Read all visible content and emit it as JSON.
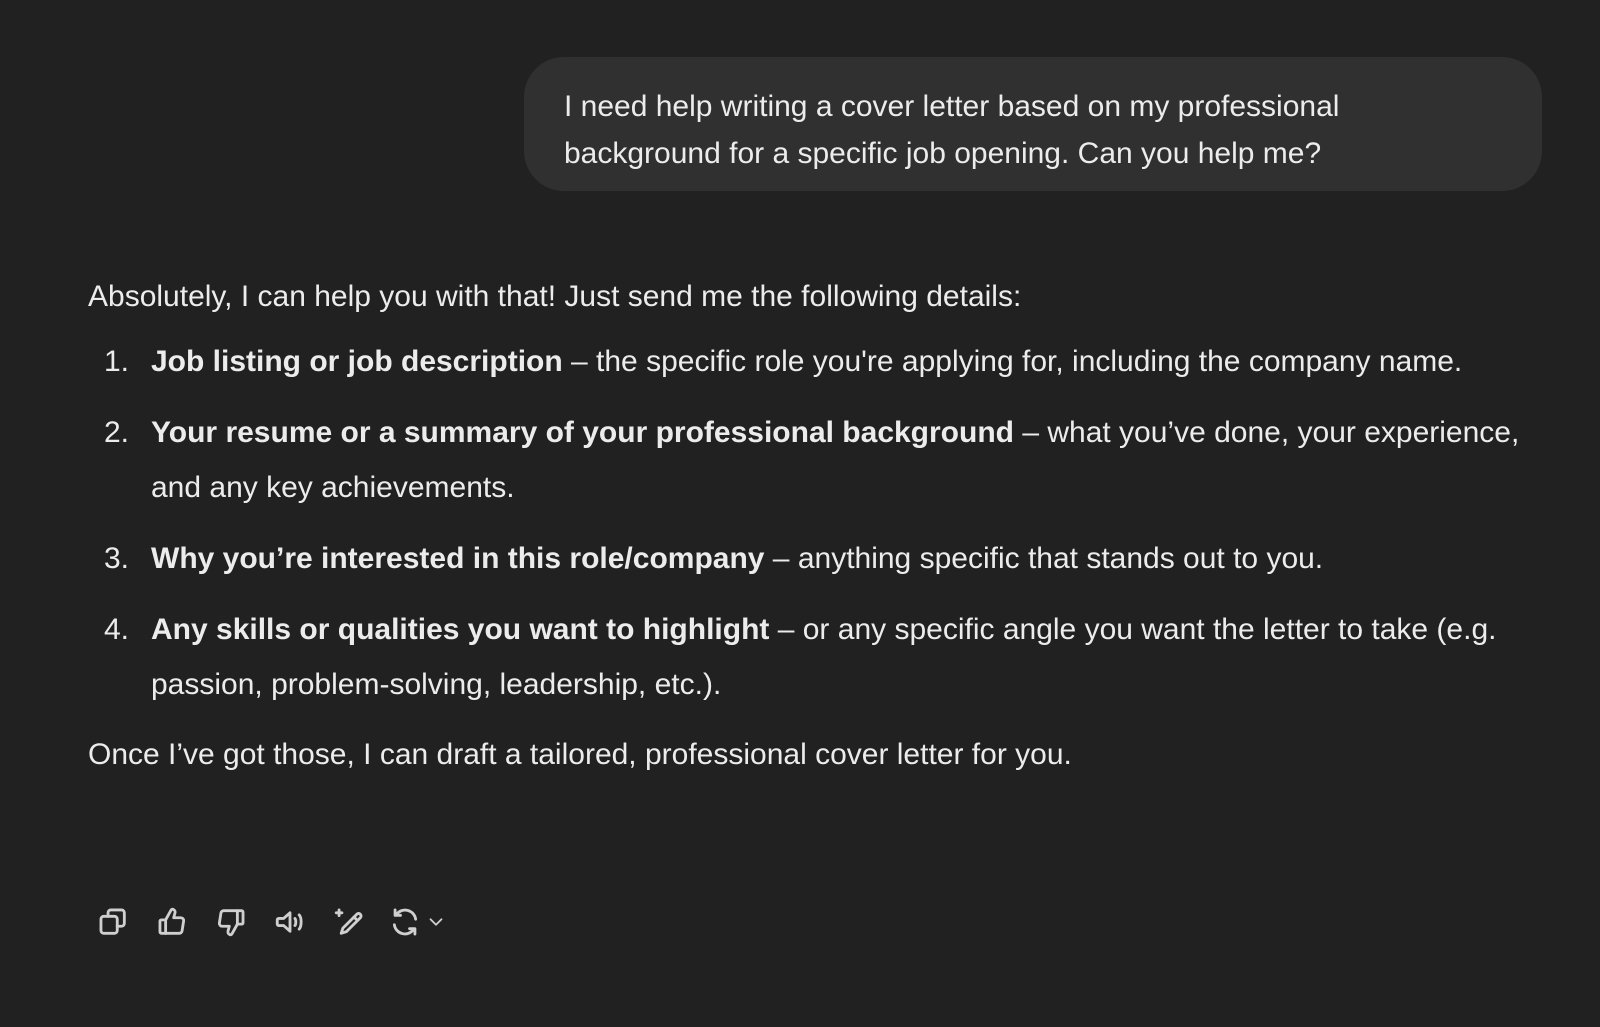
{
  "user_message": {
    "line1": "I need help writing a cover letter based on my professional",
    "line2": "background for a specific job opening. Can you help me?"
  },
  "assistant_message": {
    "intro": "Absolutely, I can help you with that! Just send me the following details:",
    "steps": [
      {
        "num": "1.",
        "title": "Job listing or job description",
        "rest": " – the specific role you're applying for, including the company name."
      },
      {
        "num": "2.",
        "title": "Your resume or a summary of your professional background",
        "rest": " – what you’ve done, your experience, and any key achievements."
      },
      {
        "num": "3.",
        "title": "Why you’re interested in this role/company",
        "rest": " – anything specific that stands out to you."
      },
      {
        "num": "4.",
        "title": "Any skills or qualities you want to highlight",
        "rest": " – or any specific angle you want the letter to take (e.g. passion, problem-solving, leadership, etc.)."
      }
    ],
    "outro": "Once I’ve got those, I can draft a tailored, professional cover letter for you."
  },
  "toolbar": {
    "icons": [
      "copy-icon",
      "thumbs-up-icon",
      "thumbs-down-icon",
      "read-aloud-icon",
      "edit-sparkle-icon",
      "regenerate-icon",
      "chevron-down-icon"
    ]
  },
  "colors": {
    "background": "#212121",
    "user_bubble": "#303030",
    "text": "#ececec",
    "icon": "#cfcfcf"
  }
}
